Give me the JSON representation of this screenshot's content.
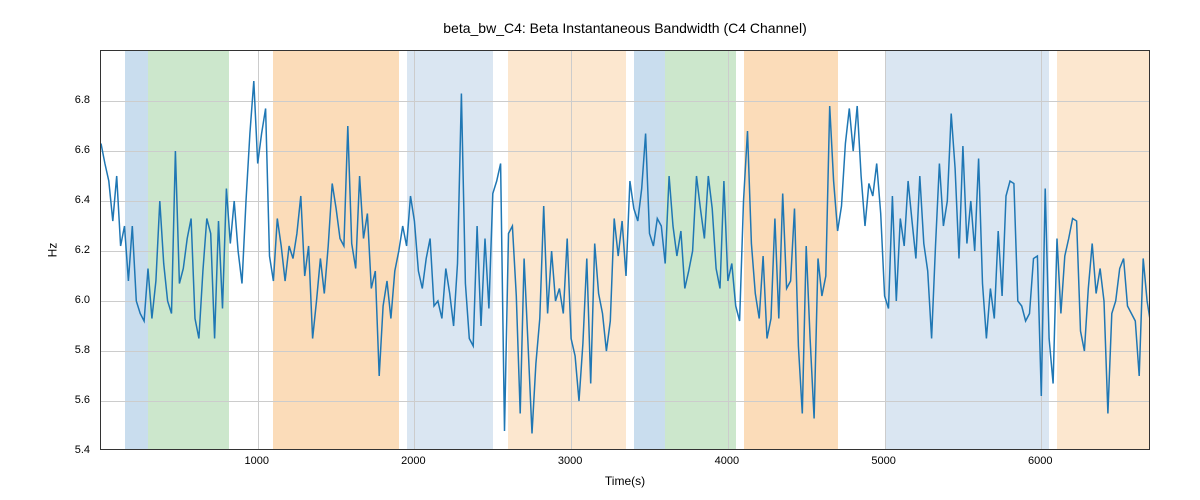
{
  "chart_data": {
    "type": "line",
    "title": "beta_bw_C4: Beta Instantaneous Bandwidth (C4 Channel)",
    "xlabel": "Time(s)",
    "ylabel": "Hz",
    "xlim": [
      0,
      6700
    ],
    "ylim": [
      5.4,
      7.0
    ],
    "xticks": [
      1000,
      2000,
      3000,
      4000,
      5000,
      6000
    ],
    "yticks": [
      5.4,
      5.6,
      5.8,
      6.0,
      6.2,
      6.4,
      6.6,
      6.8
    ],
    "bands": [
      {
        "x0": 150,
        "x1": 300,
        "color": "#c9ddee"
      },
      {
        "x0": 300,
        "x1": 820,
        "color": "#cce7cc"
      },
      {
        "x0": 1100,
        "x1": 1900,
        "color": "#fbdcb9"
      },
      {
        "x0": 1950,
        "x1": 2500,
        "color": "#dae6f2"
      },
      {
        "x0": 2600,
        "x1": 3350,
        "color": "#fce7cf"
      },
      {
        "x0": 3400,
        "x1": 3600,
        "color": "#c9ddee"
      },
      {
        "x0": 3600,
        "x1": 4050,
        "color": "#cce7cc"
      },
      {
        "x0": 4100,
        "x1": 4700,
        "color": "#fbdcb9"
      },
      {
        "x0": 5000,
        "x1": 6050,
        "color": "#dae6f2"
      },
      {
        "x0": 6100,
        "x1": 6700,
        "color": "#fce7cf"
      }
    ],
    "series": [
      {
        "name": "beta_bw_C4",
        "color": "#1f77b4",
        "x": [
          0,
          25,
          50,
          75,
          100,
          125,
          150,
          175,
          200,
          225,
          250,
          275,
          300,
          325,
          350,
          375,
          400,
          425,
          450,
          475,
          500,
          525,
          550,
          575,
          600,
          625,
          650,
          675,
          700,
          725,
          750,
          775,
          800,
          825,
          850,
          875,
          900,
          925,
          950,
          975,
          1000,
          1025,
          1050,
          1075,
          1100,
          1125,
          1150,
          1175,
          1200,
          1225,
          1250,
          1275,
          1300,
          1325,
          1350,
          1375,
          1400,
          1425,
          1450,
          1475,
          1500,
          1525,
          1550,
          1575,
          1600,
          1625,
          1650,
          1675,
          1700,
          1725,
          1750,
          1775,
          1800,
          1825,
          1850,
          1875,
          1900,
          1925,
          1950,
          1975,
          2000,
          2025,
          2050,
          2075,
          2100,
          2125,
          2150,
          2175,
          2200,
          2225,
          2250,
          2275,
          2300,
          2325,
          2350,
          2375,
          2400,
          2425,
          2450,
          2475,
          2500,
          2525,
          2550,
          2575,
          2600,
          2625,
          2650,
          2675,
          2700,
          2725,
          2750,
          2775,
          2800,
          2825,
          2850,
          2875,
          2900,
          2925,
          2950,
          2975,
          3000,
          3025,
          3050,
          3075,
          3100,
          3125,
          3150,
          3175,
          3200,
          3225,
          3250,
          3275,
          3300,
          3325,
          3350,
          3375,
          3400,
          3425,
          3450,
          3475,
          3500,
          3525,
          3550,
          3575,
          3600,
          3625,
          3650,
          3675,
          3700,
          3725,
          3750,
          3775,
          3800,
          3825,
          3850,
          3875,
          3900,
          3925,
          3950,
          3975,
          4000,
          4025,
          4050,
          4075,
          4100,
          4125,
          4150,
          4175,
          4200,
          4225,
          4250,
          4275,
          4300,
          4325,
          4350,
          4375,
          4400,
          4425,
          4450,
          4475,
          4500,
          4525,
          4550,
          4575,
          4600,
          4625,
          4650,
          4675,
          4700,
          4725,
          4750,
          4775,
          4800,
          4825,
          4850,
          4875,
          4900,
          4925,
          4950,
          4975,
          5000,
          5025,
          5050,
          5075,
          5100,
          5125,
          5150,
          5175,
          5200,
          5225,
          5250,
          5275,
          5300,
          5325,
          5350,
          5375,
          5400,
          5425,
          5450,
          5475,
          5500,
          5525,
          5550,
          5575,
          5600,
          5625,
          5650,
          5675,
          5700,
          5725,
          5750,
          5775,
          5800,
          5825,
          5850,
          5875,
          5900,
          5925,
          5950,
          5975,
          6000,
          6025,
          6050,
          6075,
          6100,
          6125,
          6150,
          6175,
          6200,
          6225,
          6250,
          6275,
          6300,
          6325,
          6350,
          6375,
          6400,
          6425,
          6450,
          6475,
          6500,
          6525,
          6550,
          6575,
          6600,
          6625,
          6650,
          6675,
          6700
        ],
        "values": [
          6.63,
          6.55,
          6.48,
          6.32,
          6.5,
          6.22,
          6.3,
          6.08,
          6.3,
          6.0,
          5.95,
          5.92,
          6.13,
          5.93,
          6.08,
          6.4,
          6.15,
          6.0,
          5.95,
          6.6,
          6.07,
          6.13,
          6.25,
          6.33,
          5.93,
          5.85,
          6.12,
          6.33,
          6.27,
          5.85,
          6.32,
          5.97,
          6.45,
          6.23,
          6.4,
          6.2,
          6.07,
          6.4,
          6.67,
          6.88,
          6.55,
          6.67,
          6.77,
          6.18,
          6.08,
          6.33,
          6.22,
          6.08,
          6.22,
          6.17,
          6.27,
          6.42,
          6.1,
          6.22,
          5.85,
          6.0,
          6.17,
          6.03,
          6.22,
          6.47,
          6.37,
          6.25,
          6.22,
          6.7,
          6.23,
          6.13,
          6.5,
          6.25,
          6.35,
          6.05,
          6.12,
          5.7,
          5.98,
          6.08,
          5.93,
          6.12,
          6.2,
          6.3,
          6.22,
          6.42,
          6.32,
          6.12,
          6.05,
          6.17,
          6.25,
          5.98,
          6.0,
          5.93,
          6.13,
          6.03,
          5.9,
          6.15,
          6.83,
          6.07,
          5.85,
          5.82,
          6.3,
          5.9,
          6.25,
          5.97,
          6.43,
          6.48,
          6.55,
          5.48,
          6.27,
          6.3,
          6.02,
          5.55,
          6.17,
          5.82,
          5.47,
          5.75,
          5.93,
          6.38,
          5.95,
          6.2,
          6.0,
          6.05,
          5.95,
          6.25,
          5.85,
          5.78,
          5.6,
          5.83,
          6.17,
          5.67,
          6.23,
          6.03,
          5.95,
          5.8,
          5.92,
          6.33,
          6.18,
          6.32,
          6.1,
          6.48,
          6.37,
          6.32,
          6.45,
          6.67,
          6.27,
          6.22,
          6.33,
          6.3,
          6.15,
          6.5,
          6.3,
          6.18,
          6.28,
          6.05,
          6.12,
          6.2,
          6.5,
          6.37,
          6.25,
          6.5,
          6.37,
          6.13,
          6.05,
          6.48,
          6.08,
          6.15,
          5.98,
          5.92,
          6.4,
          6.68,
          6.23,
          6.03,
          5.93,
          6.18,
          5.85,
          5.93,
          6.33,
          5.93,
          6.43,
          6.05,
          6.08,
          6.37,
          5.82,
          5.55,
          6.22,
          5.85,
          5.53,
          6.17,
          6.02,
          6.1,
          6.78,
          6.48,
          6.28,
          6.38,
          6.63,
          6.77,
          6.6,
          6.78,
          6.5,
          6.3,
          6.47,
          6.42,
          6.55,
          6.35,
          6.02,
          5.97,
          6.42,
          6.0,
          6.33,
          6.22,
          6.48,
          6.32,
          6.17,
          6.5,
          6.23,
          6.12,
          5.85,
          6.22,
          6.55,
          6.3,
          6.4,
          6.75,
          6.53,
          6.17,
          6.62,
          6.23,
          6.4,
          6.2,
          6.57,
          6.07,
          5.85,
          6.05,
          5.93,
          6.28,
          6.02,
          6.42,
          6.48,
          6.47,
          6.0,
          5.98,
          5.92,
          5.95,
          6.17,
          6.18,
          5.62,
          6.45,
          5.85,
          5.67,
          6.25,
          5.95,
          6.18,
          6.25,
          6.33,
          6.32,
          5.88,
          5.8,
          6.05,
          6.23,
          6.03,
          6.13,
          6.0,
          5.55,
          5.95,
          6.0,
          6.13,
          6.17,
          5.98,
          5.95,
          5.92,
          5.7,
          6.17,
          6.0,
          5.9
        ]
      }
    ]
  }
}
